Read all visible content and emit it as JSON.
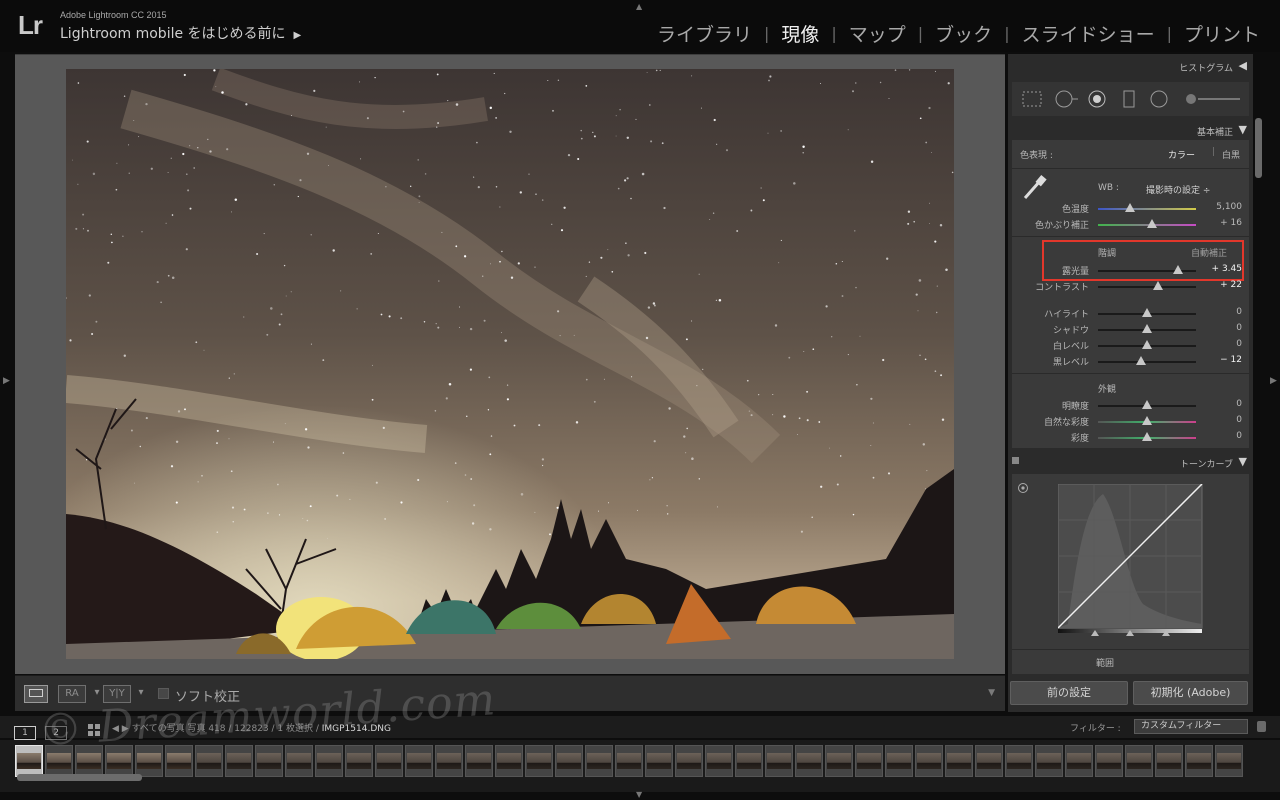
{
  "app": {
    "logo": "Lr",
    "name": "Adobe Lightroom CC 2015",
    "identity": "Lightroom mobile をはじめる前に",
    "identity_arrow": "▶"
  },
  "modules": [
    {
      "label": "ライブラリ",
      "active": false
    },
    {
      "label": "現像",
      "active": true
    },
    {
      "label": "マップ",
      "active": false
    },
    {
      "label": "ブック",
      "active": false
    },
    {
      "label": "スライドショー",
      "active": false
    },
    {
      "label": "プリント",
      "active": false
    }
  ],
  "toolbar": {
    "soft_proof_label": "ソフト校正",
    "view_ra": "RA",
    "view_yy": "Y|Y"
  },
  "panels": {
    "histogram": {
      "title": "ヒストグラム"
    },
    "basic": {
      "title": "基本補正",
      "treatment_label": "色表現 :",
      "treatment_color": "カラー",
      "treatment_bw": "白黒",
      "wb_label": "WB :",
      "wb_value": "撮影時の設定 ÷",
      "temp_label": "色温度",
      "temp_value": "5,100",
      "temp_fraction": 0.33,
      "tint_label": "色かぶり補正",
      "tint_value": "+ 16",
      "tint_fraction": 0.55,
      "tone_label": "階調",
      "auto_label": "自動補正",
      "exposure_label": "露光量",
      "exposure_value": "+ 3.45",
      "exposure_fraction": 0.82,
      "contrast_label": "コントラスト",
      "contrast_value": "+ 22",
      "contrast_fraction": 0.61,
      "highlights_label": "ハイライト",
      "highlights_value": "0",
      "highlights_fraction": 0.5,
      "shadows_label": "シャドウ",
      "shadows_value": "0",
      "shadows_fraction": 0.5,
      "whites_label": "白レベル",
      "whites_value": "0",
      "whites_fraction": 0.5,
      "blacks_label": "黒レベル",
      "blacks_value": "− 12",
      "blacks_fraction": 0.44,
      "presence_label": "外観",
      "clarity_label": "明瞭度",
      "clarity_value": "0",
      "clarity_fraction": 0.5,
      "vibrance_label": "自然な彩度",
      "vibrance_value": "0",
      "vibrance_fraction": 0.5,
      "saturation_label": "彩度",
      "saturation_value": "0",
      "saturation_fraction": 0.5
    },
    "tone_curve": {
      "title": "トーンカーブ",
      "region_label": "範囲"
    },
    "buttons": {
      "previous": "前の設定",
      "reset": "初期化 (Adobe)"
    }
  },
  "filmstrip": {
    "page1": "1",
    "page2": "2",
    "source_prefix": "すべての写真",
    "source_stats": "写真 418 / 122823 / 1 枚選択 /",
    "filename": "IMGP1514.DNG",
    "filter_label": "フィルター :",
    "filter_value": "カスタムフィルター",
    "thumb_count": 41,
    "selected_index": 0
  },
  "watermark": "© Dreamworld.com",
  "colors": {
    "highlight_box": "#e2372b",
    "active_module": "#f1f1f1"
  }
}
